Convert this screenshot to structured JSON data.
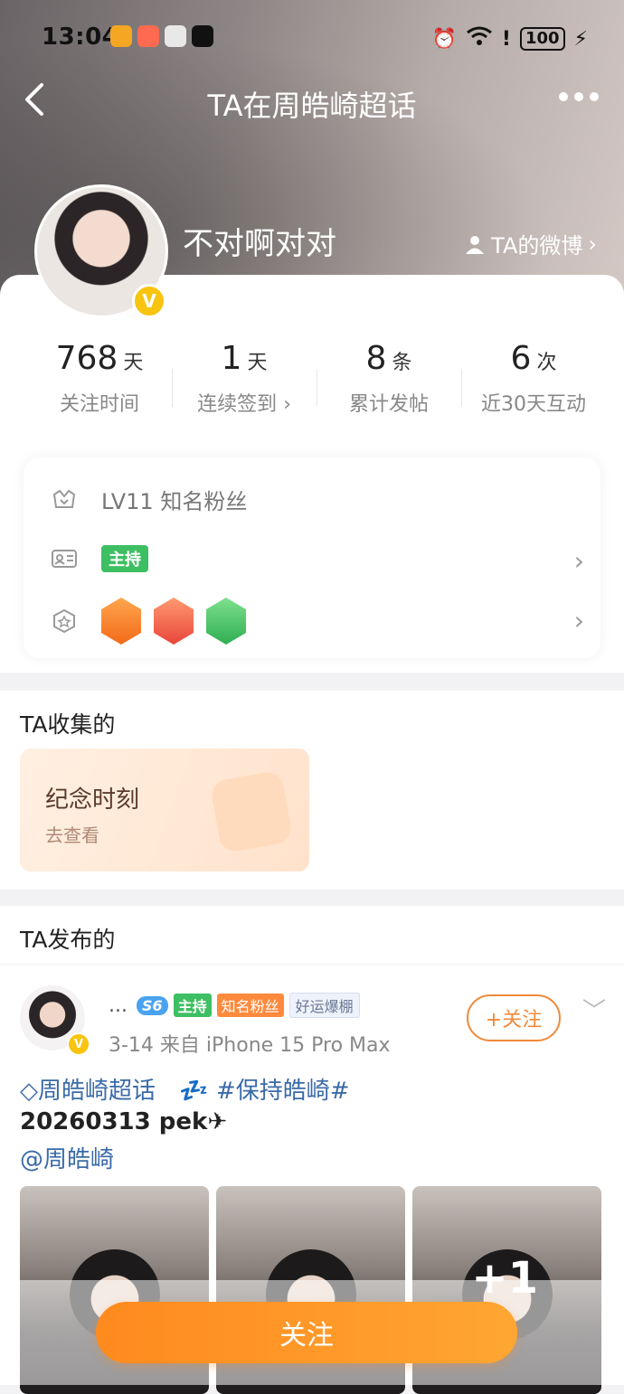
{
  "status_bar": {
    "time": "13:04",
    "battery": "100"
  },
  "nav": {
    "title": "TA在周皓崎超话"
  },
  "profile": {
    "username": "不对啊对对",
    "weibo_link": "TA的微博",
    "verified_badge": "V"
  },
  "stats": [
    {
      "num": "768",
      "unit": "天",
      "label": "关注时间"
    },
    {
      "num": "1",
      "unit": "天",
      "label": "连续签到 ›"
    },
    {
      "num": "8",
      "unit": "条",
      "label": "累计发帖"
    },
    {
      "num": "6",
      "unit": "次",
      "label": "近30天互动"
    }
  ],
  "info": {
    "level_text": "LV11 知名粉丝",
    "role_tag": "主持"
  },
  "collect": {
    "section_title": "TA收集的",
    "card_title": "纪念时刻",
    "card_sub": "去查看"
  },
  "posts": {
    "section_title": "TA发布的",
    "author_name": "...",
    "badges": {
      "level": "S6",
      "host": "主持",
      "fan": "知名粉丝",
      "luck": "好运爆棚"
    },
    "meta": "3-14  来自 iPhone 15 Pro Max",
    "follow_label": "+关注",
    "topic": "周皓崎超话",
    "hashtag": "#保持皓崎#",
    "sleep_emoji": "💤",
    "line2": "20260313 pek",
    "mention": "@周皓崎",
    "more_photos": "+1"
  },
  "bottom": {
    "follow_label": "关注"
  },
  "colors": {
    "accent": "#ff8a1e",
    "link": "#3a6aa8",
    "host_green": "#3fbf63"
  }
}
